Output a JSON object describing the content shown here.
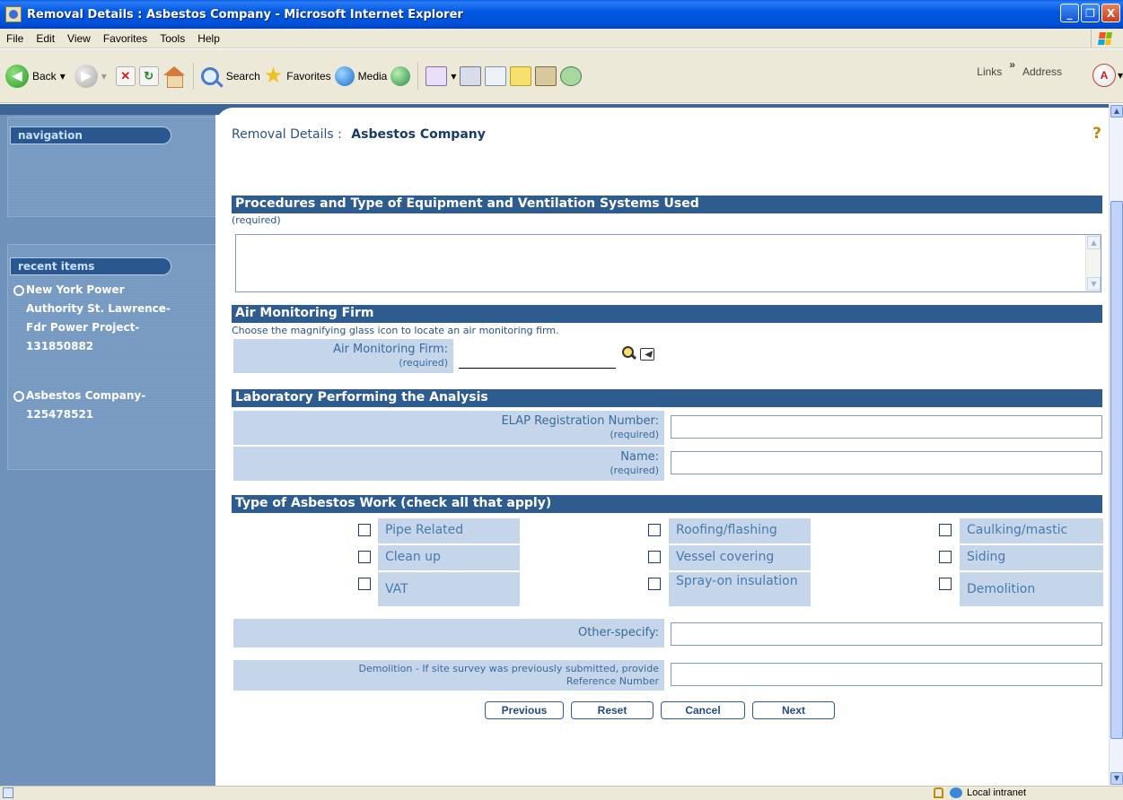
{
  "window": {
    "title": "Removal Details : Asbestos Company - Microsoft Internet Explorer",
    "minimize": "_",
    "maximize": "❐",
    "close": "X"
  },
  "menu": [
    "File",
    "Edit",
    "View",
    "Favorites",
    "Tools",
    "Help"
  ],
  "toolbar": {
    "back_label": "Back",
    "search_label": "Search",
    "favorites_label": "Favorites",
    "media_label": "Media",
    "links_label": "Links",
    "address_label": "Address",
    "chevron": "»",
    "dropdown_arrow": "▾"
  },
  "sidebar": {
    "navigation_label": "navigation",
    "recent_label": "recent items",
    "recent_items": [
      {
        "lines": [
          "New York Power",
          "Authority St. Lawrence-",
          "Fdr Power Project-",
          "131850882"
        ]
      },
      {
        "lines": [
          "Asbestos Company-",
          "125478521"
        ]
      }
    ]
  },
  "page": {
    "title_prefix": "Removal Details :",
    "title_name": "Asbestos Company",
    "help": "?"
  },
  "sections": {
    "procedures": {
      "heading": "Procedures and Type of Equipment and Ventilation Systems Used",
      "note": "(required)",
      "value": ""
    },
    "air_monitoring": {
      "heading": "Air Monitoring Firm",
      "instruction": "Choose the magnifying glass icon to locate an air monitoring firm.",
      "label": "Air Monitoring Firm:",
      "required": "(required)",
      "value": ""
    },
    "laboratory": {
      "heading": "Laboratory Performing the Analysis",
      "elap_label": "ELAP Registration Number:",
      "elap_required": "(required)",
      "elap_value": "",
      "name_label": "Name:",
      "name_required": "(required)",
      "name_value": ""
    },
    "work_type": {
      "heading": "Type of Asbestos Work (check all that apply)",
      "options": [
        {
          "label": "Pipe Related",
          "checked": false
        },
        {
          "label": "Roofing/flashing",
          "checked": false
        },
        {
          "label": "Caulking/mastic",
          "checked": false
        },
        {
          "label": "Clean up",
          "checked": false
        },
        {
          "label": "Vessel covering",
          "checked": false
        },
        {
          "label": "Siding",
          "checked": false
        },
        {
          "label": "VAT",
          "checked": false
        },
        {
          "label": "Spray-on insulation",
          "checked": false
        },
        {
          "label": "Demolition",
          "checked": false
        }
      ],
      "other_label": "Other-specify:",
      "other_value": "",
      "demolition_label_1": "Demolition - If site survey was previously submitted, provide",
      "demolition_label_2": "Reference Number",
      "demolition_value": ""
    }
  },
  "buttons": {
    "previous": "Previous",
    "reset": "Reset",
    "cancel": "Cancel",
    "next": "Next"
  },
  "status": {
    "zone": "Local intranet"
  },
  "colors": {
    "section_header": "#2e5c8e",
    "label_cell": "#c5d6ea",
    "sidebar": "#6e92ba",
    "title_bar": "#0050d8"
  }
}
